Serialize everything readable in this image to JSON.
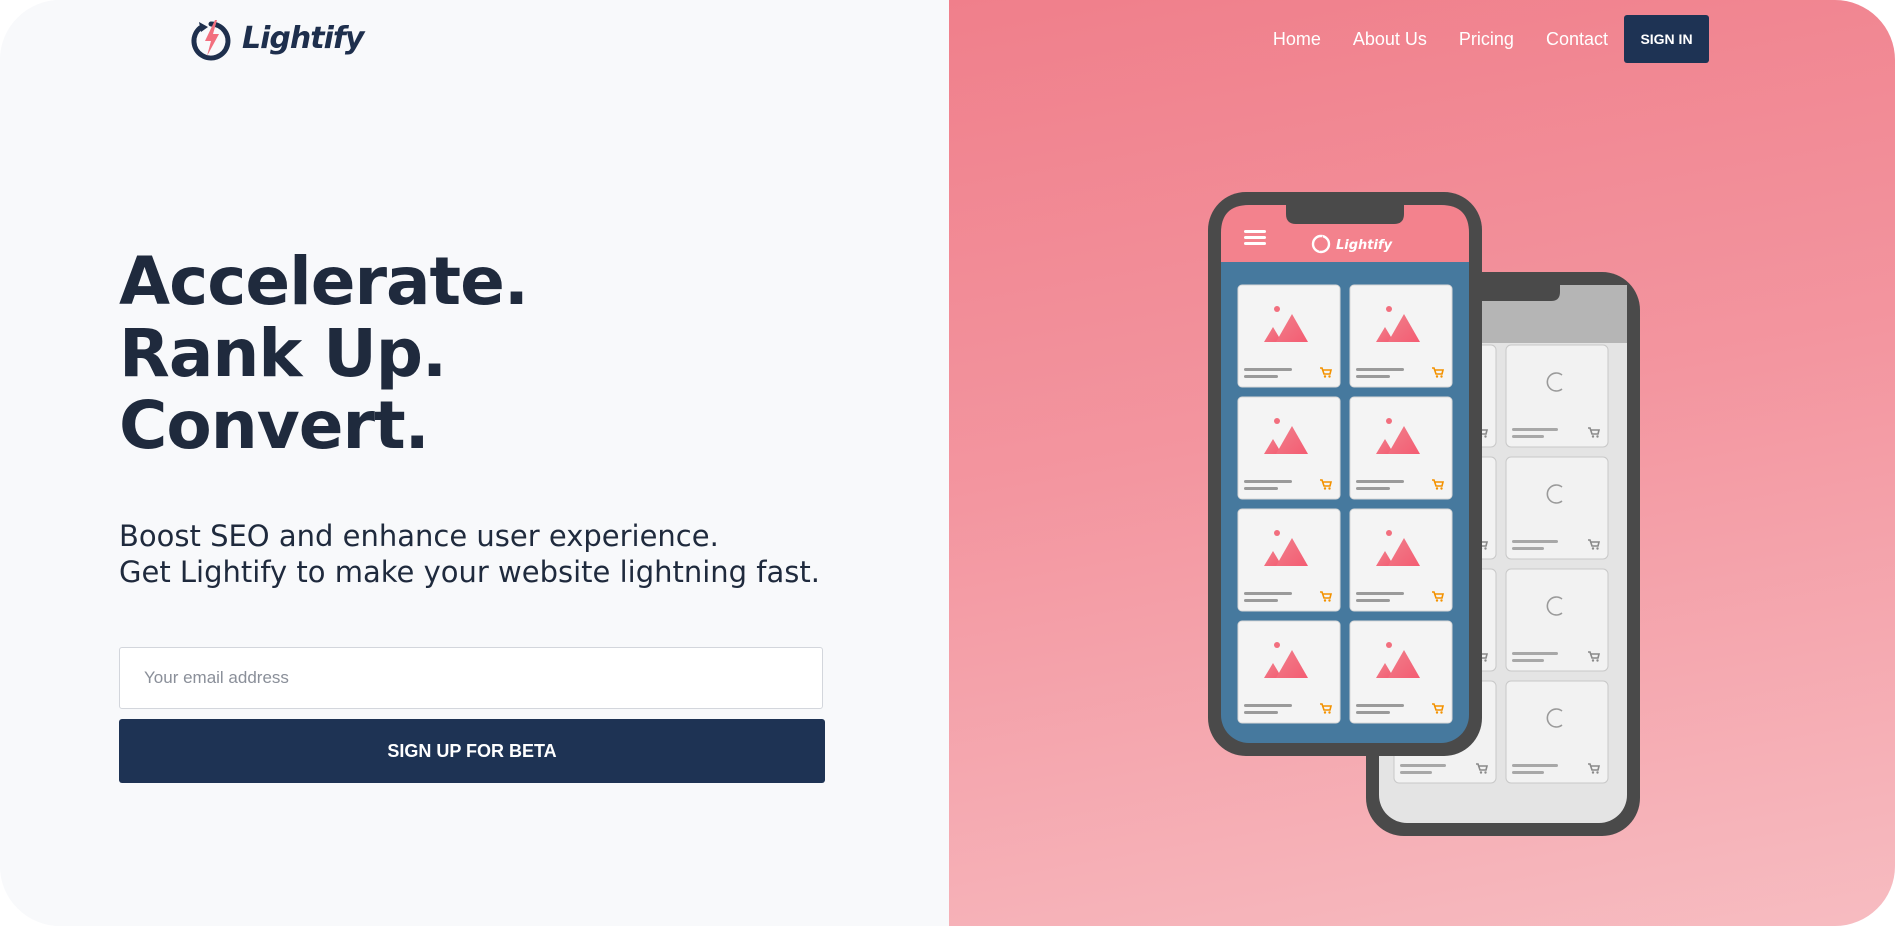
{
  "brand": {
    "name": "Lightify",
    "colors": {
      "navy": "#1e3354",
      "pink": "#f07f8b",
      "accent": "#f26f7e",
      "phone_blue": "#46799e",
      "cart_orange": "#f39200"
    }
  },
  "nav": {
    "items": [
      {
        "label": "Home"
      },
      {
        "label": "About Us"
      },
      {
        "label": "Pricing"
      },
      {
        "label": "Contact"
      }
    ],
    "signin_label": "SIGN IN"
  },
  "hero": {
    "lines": [
      "Accelerate.",
      "Rank Up.",
      "Convert."
    ],
    "subtitle_lines": [
      "Boost SEO and enhance user experience.",
      "Get Lightify to make your website lightning fast."
    ]
  },
  "signup": {
    "email_placeholder": "Your email address",
    "email_value": "",
    "button_label": "SIGN UP FOR BETA"
  },
  "illustration": {
    "front_phone_brand": "Lightify",
    "front_cards": 8,
    "back_cards": 8,
    "icons": [
      "menu-icon",
      "image-placeholder-icon",
      "cart-icon",
      "loading-spinner-icon"
    ]
  }
}
